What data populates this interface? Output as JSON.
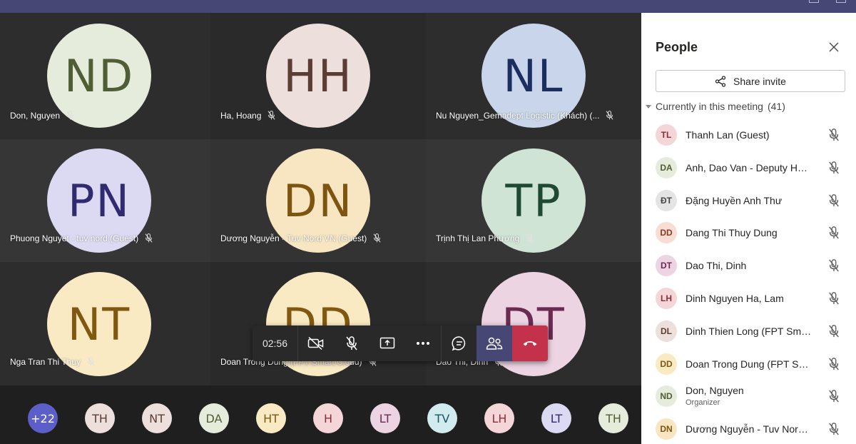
{
  "stage": {
    "tiles": [
      {
        "initials": "ND",
        "name": "Don, Nguyen",
        "bg": "#e6ecdb",
        "fg": "#4f5e34",
        "tile": "#2d2d2d"
      },
      {
        "initials": "HH",
        "name": "Ha, Hoang",
        "bg": "#ecdfdc",
        "fg": "#5c3d33",
        "tile": "#2a2a2a"
      },
      {
        "initials": "NL",
        "name": "Nu Nguyen_Gemadept Logistic (Khách) (...",
        "bg": "#c8d5ea",
        "fg": "#1b2e5f",
        "tile": "#2d2d2d"
      },
      {
        "initials": "PN",
        "name": "Phuong Nguyet - tuv nord (Guest)",
        "bg": "#dcdaf3",
        "fg": "#2f2b6e",
        "tile": "#363636"
      },
      {
        "initials": "DN",
        "name": "Dương Nguyễn - Tuv Nord VN (Guest)",
        "bg": "#f8e6c2",
        "fg": "#7d5511",
        "tile": "#333333"
      },
      {
        "initials": "TP",
        "name": "Trịnh Thị Lan Phương",
        "bg": "#d0e4d6",
        "fg": "#1d4a30",
        "tile": "#363636"
      },
      {
        "initials": "NT",
        "name": "Nga Tran Thi Thuy",
        "bg": "#faeac4",
        "fg": "#805810",
        "tile": "#2d2d2d"
      },
      {
        "initials": "DD",
        "name": "Doan Trong Dung (FPT Smart Cloud)",
        "bg": "#faeac4",
        "fg": "#805810",
        "tile": "#2a2a2a"
      },
      {
        "initials": "DT",
        "name": "Dao Thi, Dinh",
        "bg": "#ecd4e3",
        "fg": "#6b2a52",
        "tile": "#2d2d2d"
      }
    ],
    "strip": [
      {
        "initials": "+22",
        "bg": "#5b5fc7",
        "fg": "#ffffff"
      },
      {
        "initials": "TH",
        "bg": "#ecdfdc",
        "fg": "#5c3d33"
      },
      {
        "initials": "NT",
        "bg": "#ecdfdc",
        "fg": "#5c3d33"
      },
      {
        "initials": "DA",
        "bg": "#e6ecdb",
        "fg": "#4f5e34"
      },
      {
        "initials": "HT",
        "bg": "#faeac4",
        "fg": "#805810"
      },
      {
        "initials": "H",
        "bg": "#f4d6d9",
        "fg": "#8b2e3c"
      },
      {
        "initials": "LT",
        "bg": "#ecd4e3",
        "fg": "#6b2a52"
      },
      {
        "initials": "TV",
        "bg": "#d2ebef",
        "fg": "#1a5560"
      },
      {
        "initials": "LH",
        "bg": "#f4d6d9",
        "fg": "#8b2e3c"
      },
      {
        "initials": "LT",
        "bg": "#dcdaf3",
        "fg": "#2f2b6e"
      },
      {
        "initials": "TH",
        "bg": "#e6ecdb",
        "fg": "#4f5e34"
      }
    ]
  },
  "controls": {
    "timer": "02:56",
    "camera_icon": "camera-off-icon",
    "mic_icon": "mic-off-icon",
    "share_icon": "share-screen-icon",
    "more_icon": "more-icon",
    "chat_icon": "chat-icon",
    "people_icon": "people-icon",
    "hangup_icon": "hang-up-icon"
  },
  "panel": {
    "title": "People",
    "share_invite": "Share invite",
    "section_label": "Currently in this meeting",
    "section_count": "(41)",
    "people": [
      {
        "initials": "TL",
        "name": "Thanh Lan (Guest)",
        "role": "",
        "bg": "#f4d6d9",
        "fg": "#8b2e3c"
      },
      {
        "initials": "DA",
        "name": "Anh, Dao Van - Deputy Hea...",
        "role": "",
        "bg": "#e6ecdb",
        "fg": "#4f5e34"
      },
      {
        "initials": "ĐT",
        "name": "Đặng Huyền Anh Thư",
        "role": "",
        "bg": "#e4e4e4",
        "fg": "#484644"
      },
      {
        "initials": "DD",
        "name": "Dang Thi Thuy Dung",
        "role": "",
        "bg": "#f8ddd5",
        "fg": "#8b3a22"
      },
      {
        "initials": "DT",
        "name": "Dao Thi, Dinh",
        "role": "",
        "bg": "#ecd4e3",
        "fg": "#6b2a52"
      },
      {
        "initials": "LH",
        "name": "Dinh Nguyen Ha, Lam",
        "role": "",
        "bg": "#f4d6d9",
        "fg": "#8b2e3c"
      },
      {
        "initials": "DL",
        "name": "Dinh Thien Long (FPT Smart ...",
        "role": "",
        "bg": "#ecdfdc",
        "fg": "#5c3d33"
      },
      {
        "initials": "DD",
        "name": "Doan Trong Dung (FPT Smar...",
        "role": "",
        "bg": "#faeac4",
        "fg": "#805810"
      },
      {
        "initials": "ND",
        "name": "Don, Nguyen",
        "role": "Organizer",
        "bg": "#e6ecdb",
        "fg": "#4f5e34"
      },
      {
        "initials": "DN",
        "name": "Dương Nguyễn - Tuv Nord ...",
        "role": "",
        "bg": "#f8e6c2",
        "fg": "#7d5511"
      }
    ]
  }
}
